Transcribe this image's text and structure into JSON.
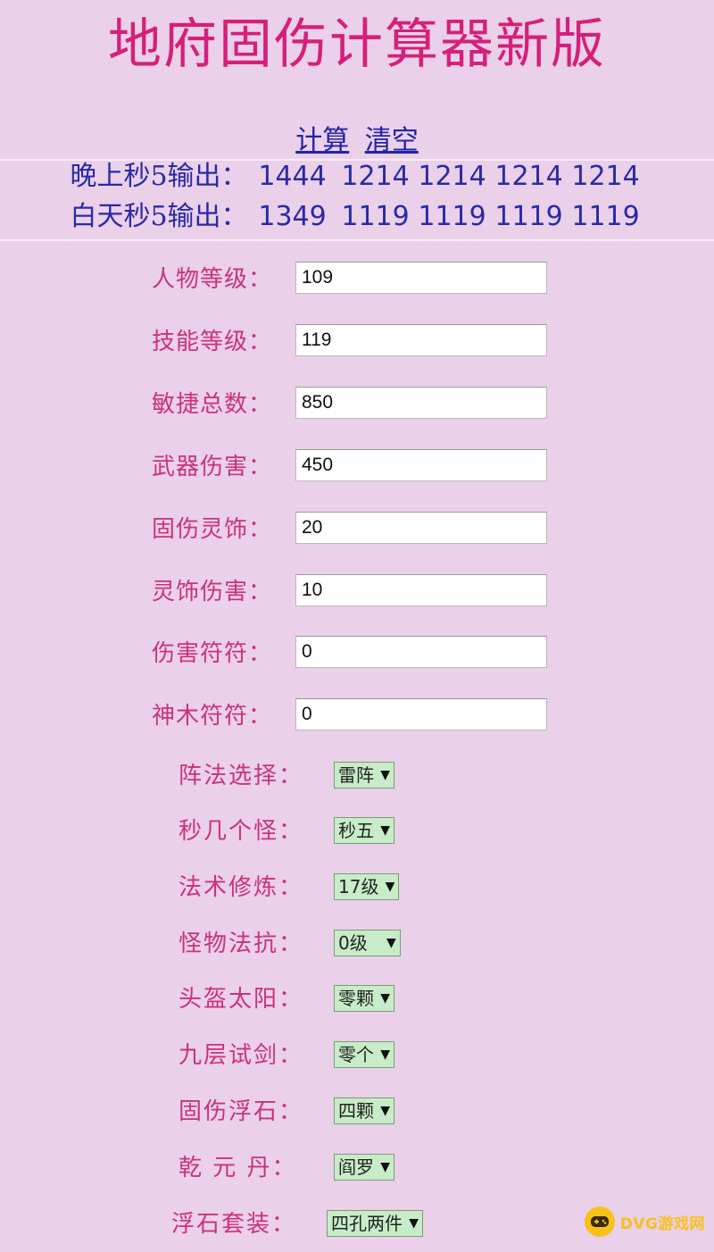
{
  "title": "地府固伤计算器新版",
  "actions": {
    "calculate": "计算",
    "clear": "清空"
  },
  "results": {
    "night": {
      "label": "晚上秒5输出：",
      "values": [
        "1444",
        "1214",
        "1214",
        "1214",
        "1214"
      ]
    },
    "day": {
      "label": "白天秒5输出：",
      "values": [
        "1349",
        "1119",
        "1119",
        "1119",
        "1119"
      ]
    }
  },
  "fields": [
    {
      "label": "人物等级：",
      "value": "109"
    },
    {
      "label": "技能等级：",
      "value": "119"
    },
    {
      "label": "敏捷总数：",
      "value": "850"
    },
    {
      "label": "武器伤害：",
      "value": "450"
    },
    {
      "label": "固伤灵饰：",
      "value": "20"
    },
    {
      "label": "灵饰伤害：",
      "value": "10"
    },
    {
      "label": "伤害符符：",
      "value": "0"
    },
    {
      "label": "神木符符：",
      "value": "0"
    }
  ],
  "selects": [
    {
      "label": "阵法选择：",
      "value": "雷阵"
    },
    {
      "label": "秒几个怪：",
      "value": "秒五"
    },
    {
      "label": "法术修炼：",
      "value": "17级"
    },
    {
      "label": "怪物法抗：",
      "value": "0级"
    },
    {
      "label": "头盔太阳：",
      "value": "零颗"
    },
    {
      "label": "九层试剑：",
      "value": "零个"
    },
    {
      "label": "固伤浮石：",
      "value": "四颗"
    },
    {
      "label": "乾 元 丹：",
      "value": "阎罗"
    },
    {
      "label": "浮石套装：",
      "value": "四孔两件"
    }
  ],
  "arrow_glyph": "▼",
  "watermark": {
    "text": "DVG游戏网"
  }
}
